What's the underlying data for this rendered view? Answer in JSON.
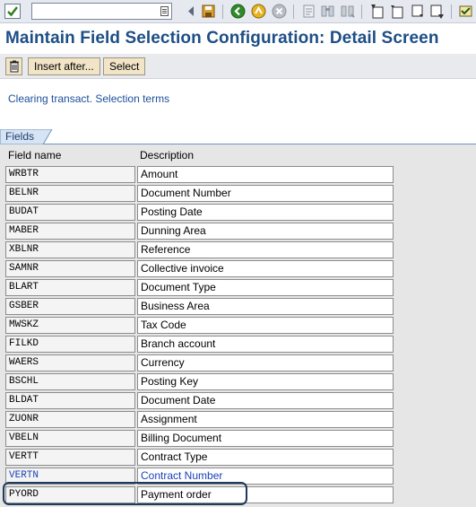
{
  "toolbar": {
    "icons": [
      "enter-icon",
      "save-icon",
      "back-icon",
      "exit-icon",
      "cancel-icon",
      "print-icon",
      "find-icon",
      "find-next-icon",
      "first-page-icon",
      "previous-page-icon",
      "next-page-icon",
      "last-page-icon",
      "new-session-icon"
    ]
  },
  "page": {
    "title": "Maintain Field Selection Configuration: Detail Screen"
  },
  "app_toolbar": {
    "insert_label": "Insert after...",
    "select_label": "Select"
  },
  "caption": "Clearing transact. Selection terms",
  "group": {
    "title": "Fields",
    "col_field": "Field name",
    "col_desc": "Description",
    "rows": [
      {
        "field": "WRBTR",
        "desc": "Amount"
      },
      {
        "field": "BELNR",
        "desc": "Document Number"
      },
      {
        "field": "BUDAT",
        "desc": "Posting Date"
      },
      {
        "field": "MABER",
        "desc": "Dunning Area"
      },
      {
        "field": "XBLNR",
        "desc": "Reference"
      },
      {
        "field": "SAMNR",
        "desc": "Collective invoice"
      },
      {
        "field": "BLART",
        "desc": "Document Type"
      },
      {
        "field": "GSBER",
        "desc": "Business Area"
      },
      {
        "field": "MWSKZ",
        "desc": "Tax Code"
      },
      {
        "field": "FILKD",
        "desc": "Branch account"
      },
      {
        "field": "WAERS",
        "desc": "Currency"
      },
      {
        "field": "BSCHL",
        "desc": "Posting Key"
      },
      {
        "field": "BLDAT",
        "desc": "Document Date"
      },
      {
        "field": "ZUONR",
        "desc": "Assignment"
      },
      {
        "field": "VBELN",
        "desc": "Billing Document"
      },
      {
        "field": "VERTT",
        "desc": "Contract Type"
      },
      {
        "field": "VERTN",
        "desc": "Contract Number"
      },
      {
        "field": "PYORD",
        "desc": "Payment order"
      }
    ]
  },
  "colors": {
    "title": "#1d4e86",
    "link_row": "#1a3fb8",
    "highlight": "#1d3a5e"
  }
}
